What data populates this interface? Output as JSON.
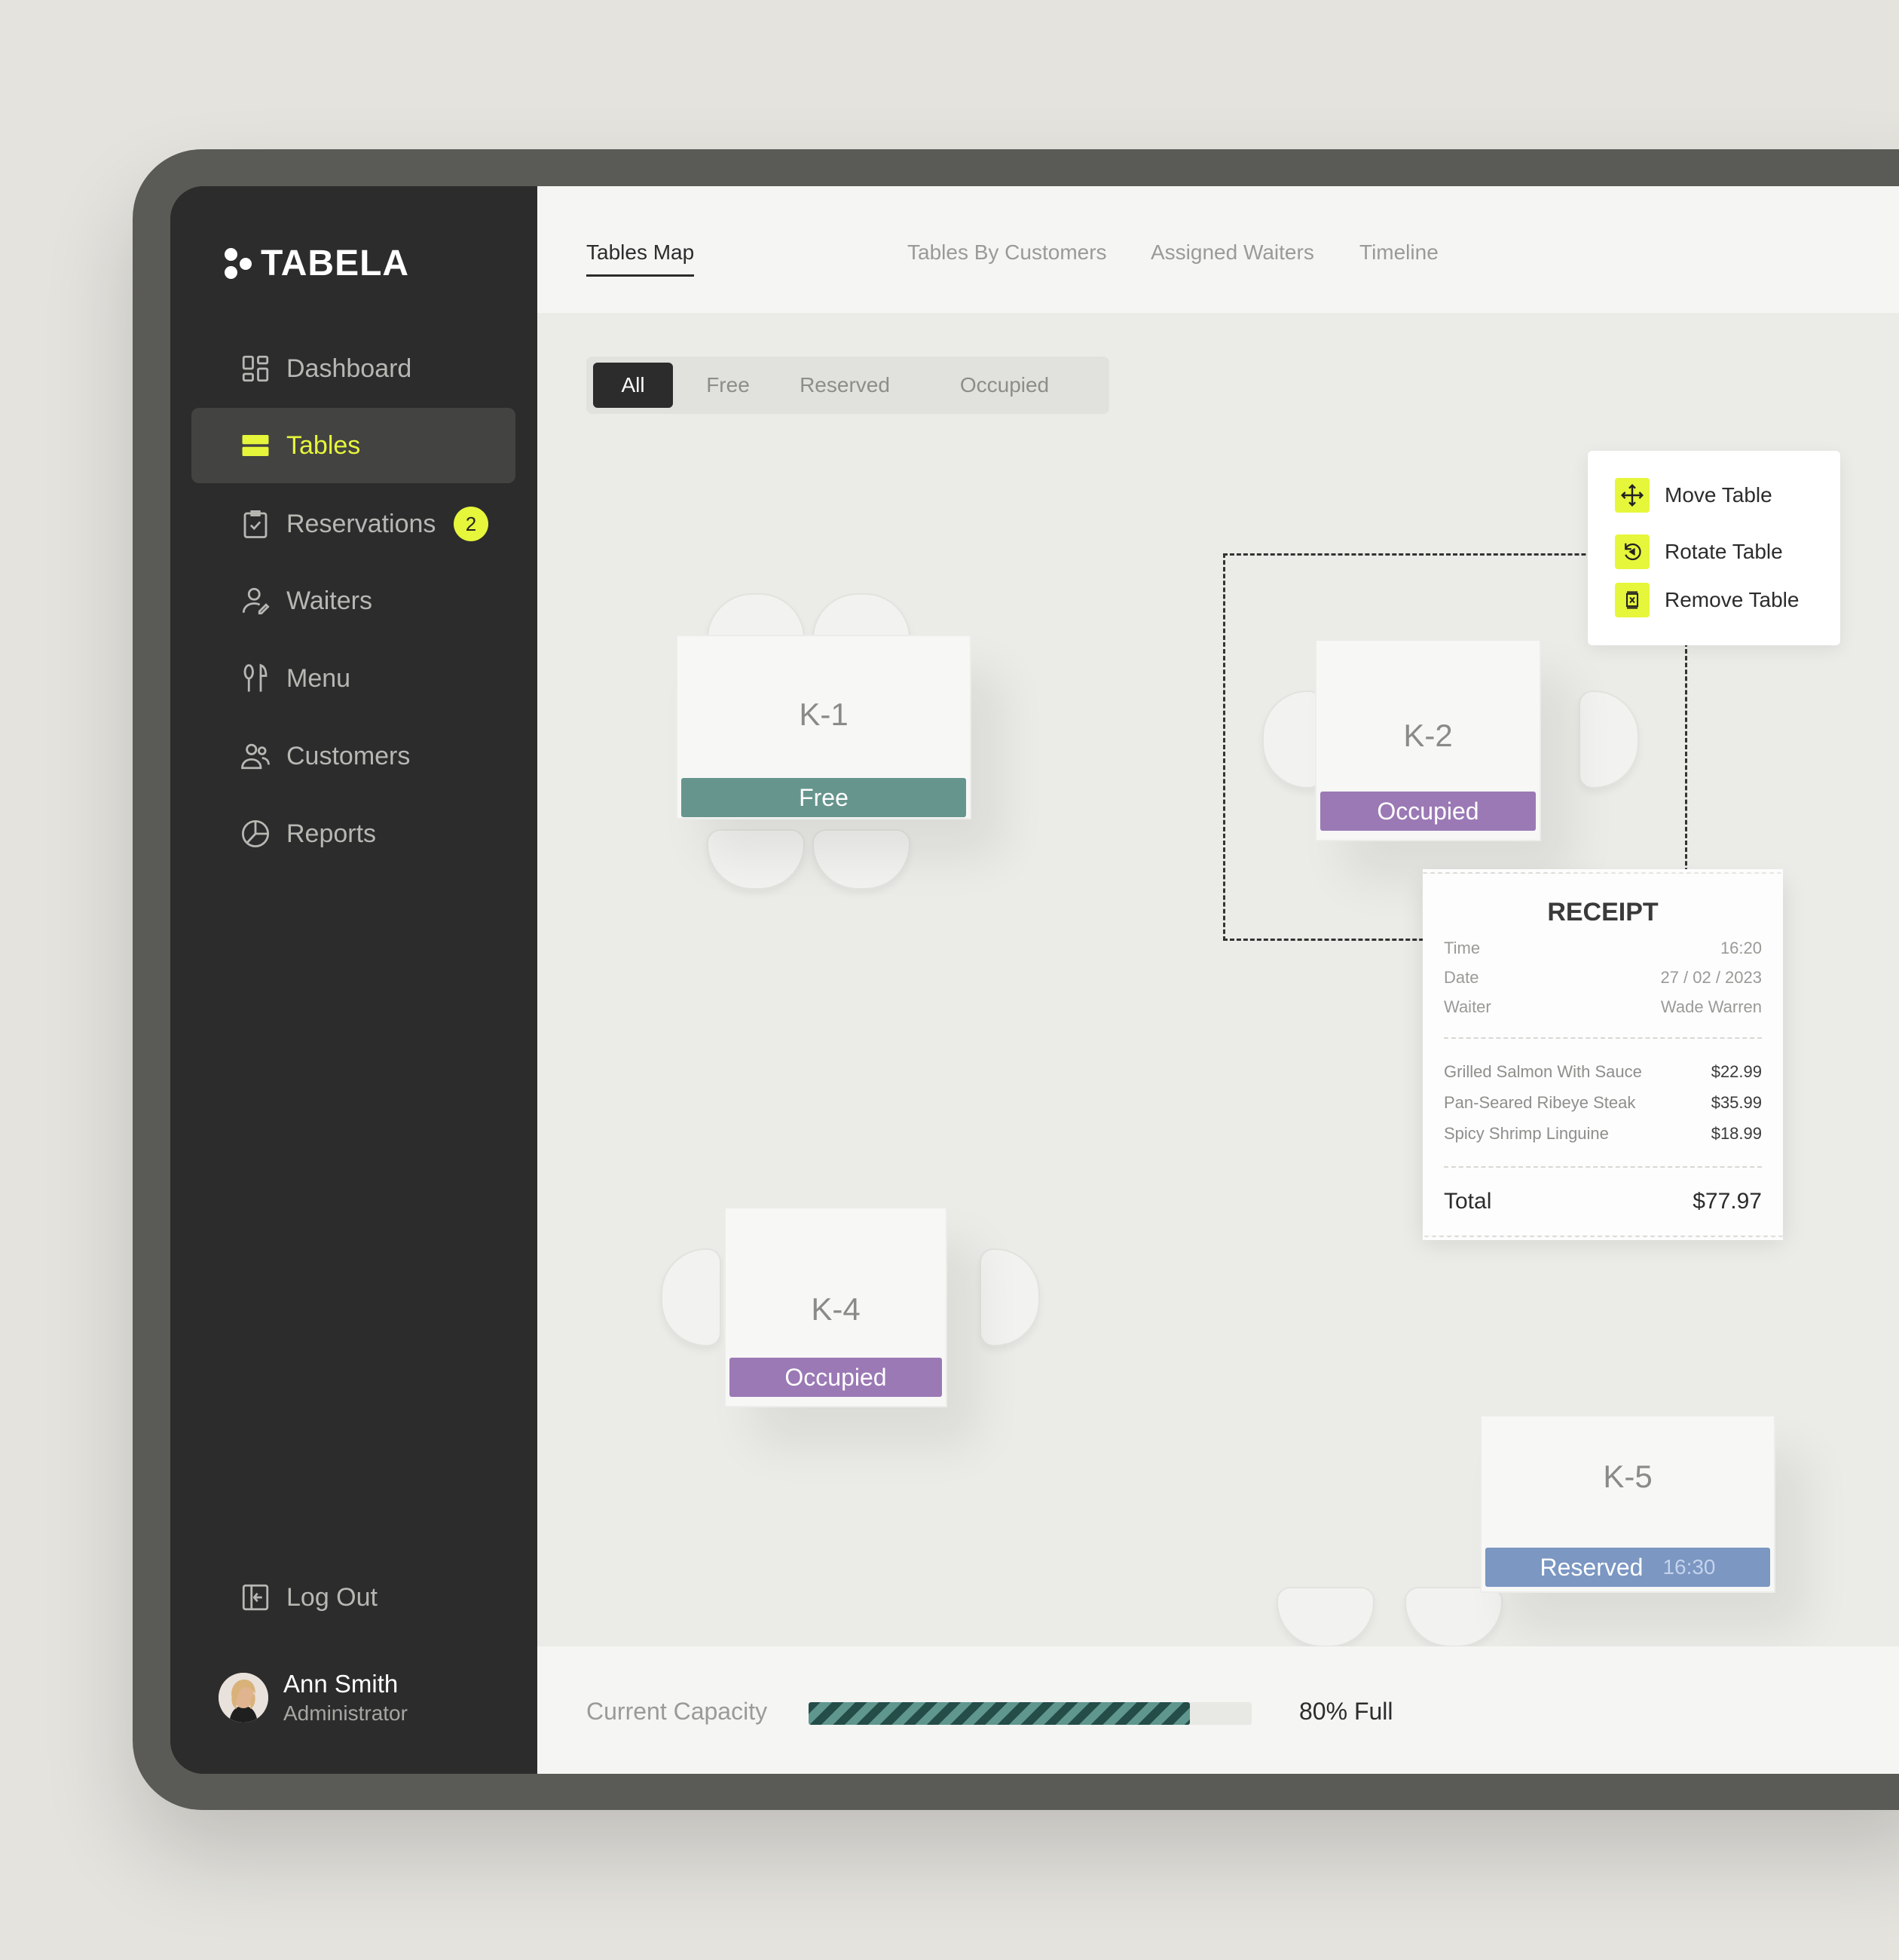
{
  "app": {
    "name": "TABELA"
  },
  "sidebar": {
    "items": [
      {
        "label": "Dashboard",
        "icon": "dashboard-icon"
      },
      {
        "label": "Tables",
        "icon": "tables-icon",
        "active": true
      },
      {
        "label": "Reservations",
        "icon": "clipboard-check-icon",
        "badge": "2"
      },
      {
        "label": "Waiters",
        "icon": "waiter-icon"
      },
      {
        "label": "Menu",
        "icon": "utensils-icon"
      },
      {
        "label": "Customers",
        "icon": "customers-icon"
      },
      {
        "label": "Reports",
        "icon": "pie-chart-icon"
      }
    ],
    "logout": {
      "label": "Log Out",
      "icon": "logout-icon"
    },
    "user": {
      "name": "Ann Smith",
      "role": "Administrator"
    }
  },
  "tabs": [
    {
      "label": "Tables Map",
      "active": true
    },
    {
      "label": "Tables By Customers"
    },
    {
      "label": "Assigned Waiters"
    },
    {
      "label": "Timeline"
    }
  ],
  "filters": [
    {
      "label": "All",
      "active": true
    },
    {
      "label": "Free"
    },
    {
      "label": "Reserved"
    },
    {
      "label": "Occupied"
    }
  ],
  "tables": {
    "k1": {
      "name": "K-1",
      "status": "Free"
    },
    "k2": {
      "name": "K-2",
      "status": "Occupied"
    },
    "k4": {
      "name": "K-4",
      "status": "Occupied"
    },
    "k5": {
      "name": "K-5",
      "status": "Reserved",
      "time": "16:30"
    }
  },
  "status_colors": {
    "free": "#66958d",
    "occupied": "#9b79b5",
    "reserved": "#7b97c2",
    "accent": "#e6f63b"
  },
  "context_menu": {
    "move": "Move Table",
    "rotate": "Rotate Table",
    "remove": "Remove Table"
  },
  "receipt": {
    "title": "RECEIPT",
    "time_label": "Time",
    "time": "16:20",
    "date_label": "Date",
    "date": "27 / 02 / 2023",
    "waiter_label": "Waiter",
    "waiter": "Wade Warren",
    "items": [
      {
        "name": "Grilled Salmon With  Sauce",
        "price": "$22.99"
      },
      {
        "name": "Pan-Seared Ribeye Steak",
        "price": "$35.99"
      },
      {
        "name": "Spicy Shrimp Linguine",
        "price": "$18.99"
      }
    ],
    "total_label": "Total",
    "total": "$77.97"
  },
  "capacity": {
    "label": "Current Capacity",
    "value_text": "80% Full",
    "fraction": 0.86
  }
}
